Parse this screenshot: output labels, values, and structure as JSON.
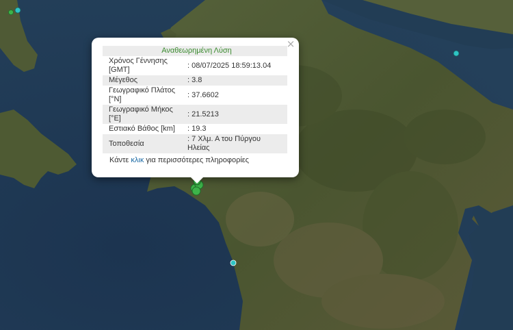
{
  "popup": {
    "title": "Αναθεωρημένη Λύση",
    "close_symbol": "×",
    "rows": [
      {
        "label": "Χρόνος Γέννησης [GMT]",
        "value": ": 08/07/2025 18:59:13.04"
      },
      {
        "label": "Μέγεθος",
        "value": ": 3.8"
      },
      {
        "label": "Γεωγραφικό Πλάτος [°N]",
        "value": ": 37.6602"
      },
      {
        "label": "Γεωγραφικό Μήκος [°E]",
        "value": ": 21.5213"
      },
      {
        "label": "Εστιακό Βάθος [km]",
        "value": ": 19.3"
      },
      {
        "label": "Τοποθεσία",
        "value": ": 7 Χλμ. Α του Πύργου Ηλείας"
      }
    ],
    "more_prefix": "Κάντε ",
    "more_link": "κλικ",
    "more_suffix": " για περισσότερες πληροφορίες"
  },
  "colors": {
    "sea": "#1f3a52",
    "land": "#4d5a2e",
    "quake_green": "#3db34a",
    "quake_cyan": "#2ec4c4",
    "title_green": "#3a8a2e",
    "link_blue": "#1a6aa5"
  },
  "markers": {
    "icon": "earthquake-marker-icon"
  }
}
